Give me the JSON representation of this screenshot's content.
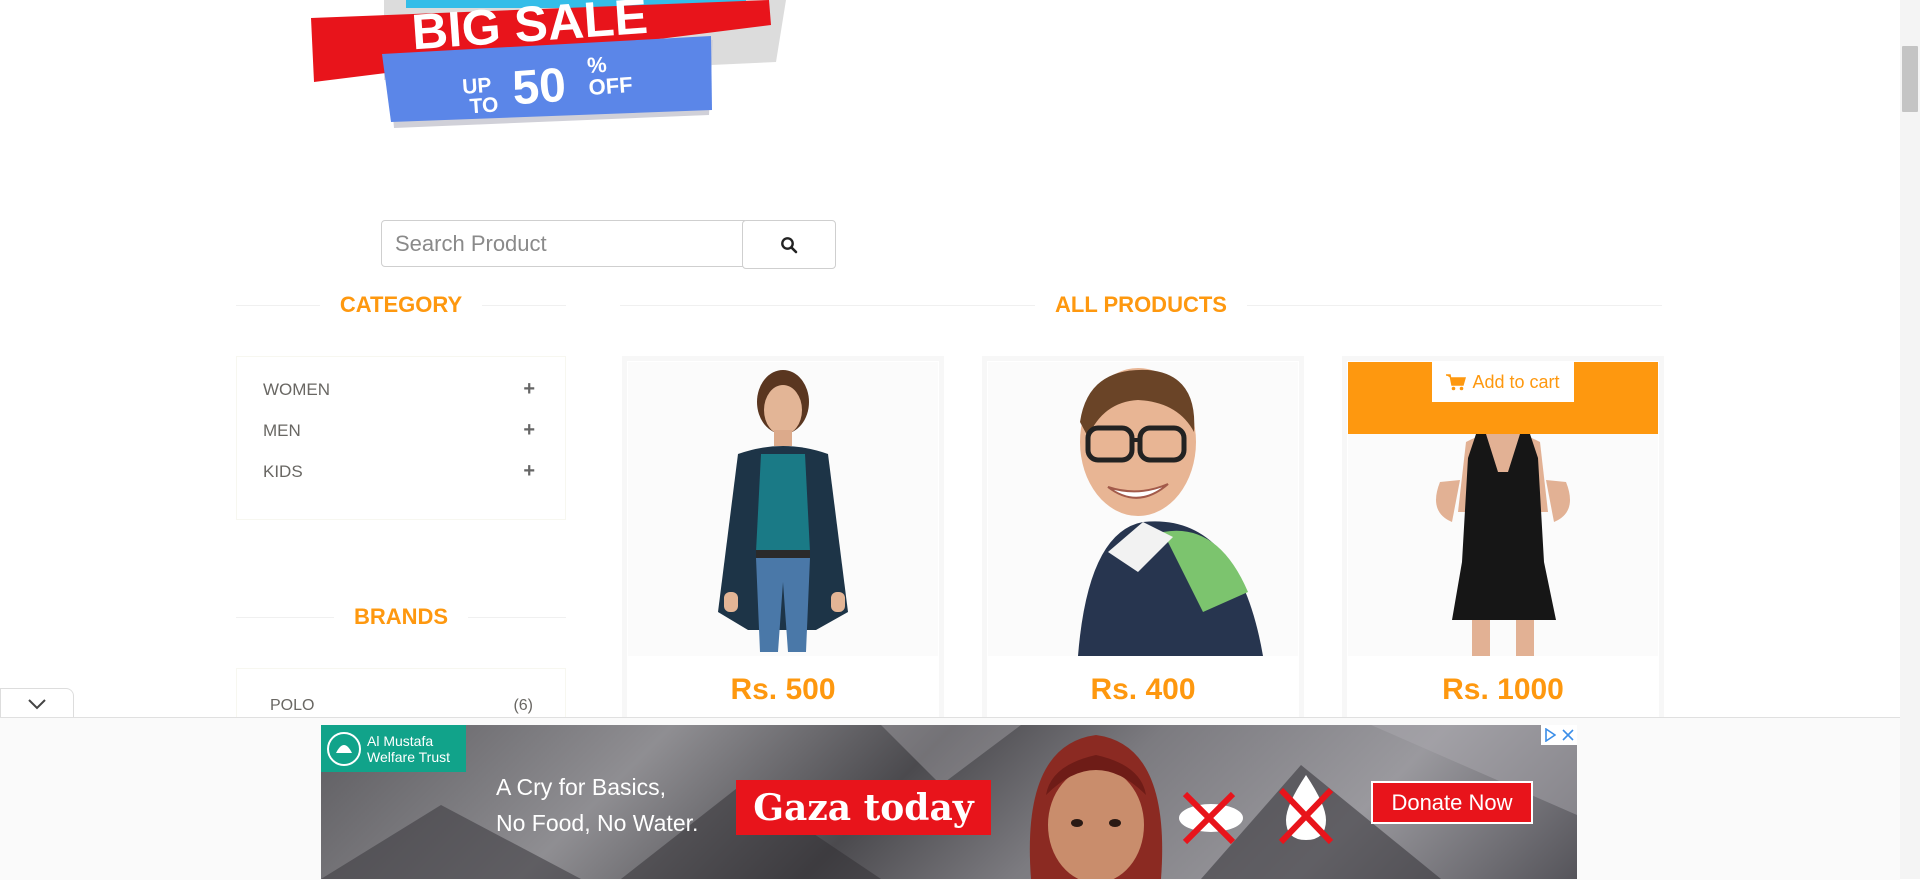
{
  "banner": {
    "line1": "BIG SALE",
    "up_to": "UP",
    "to": "TO",
    "percent": "50",
    "percent_sign": "%",
    "off": "OFF"
  },
  "search": {
    "placeholder": "Search Product",
    "icon": "search-icon"
  },
  "sidebar": {
    "category_title": "CATEGORY",
    "categories": [
      {
        "label": "WOMEN",
        "icon": "plus-icon"
      },
      {
        "label": "MEN",
        "icon": "plus-icon"
      },
      {
        "label": "KIDS",
        "icon": "plus-icon"
      }
    ],
    "brands_title": "BRANDS",
    "brands": [
      {
        "label": "POLO",
        "count": "(6)"
      }
    ]
  },
  "main": {
    "title": "ALL PRODUCTS",
    "products": [
      {
        "price": "Rs. 500"
      },
      {
        "price": "Rs. 400"
      },
      {
        "price": "Rs. 1000",
        "cart_label": "Add to cart",
        "cart_icon": "shopping-cart-icon"
      }
    ]
  },
  "colors": {
    "accent": "#fe980f",
    "ad_red": "#e8141b",
    "ad_teal": "#11a38a"
  },
  "ad": {
    "org_line1": "Al Mustafa",
    "org_line2": "Welfare Trust",
    "tagline1": "A Cry for Basics,",
    "tagline2": "No Food, No Water.",
    "headline": "Gaza today",
    "cta": "Donate Now"
  }
}
